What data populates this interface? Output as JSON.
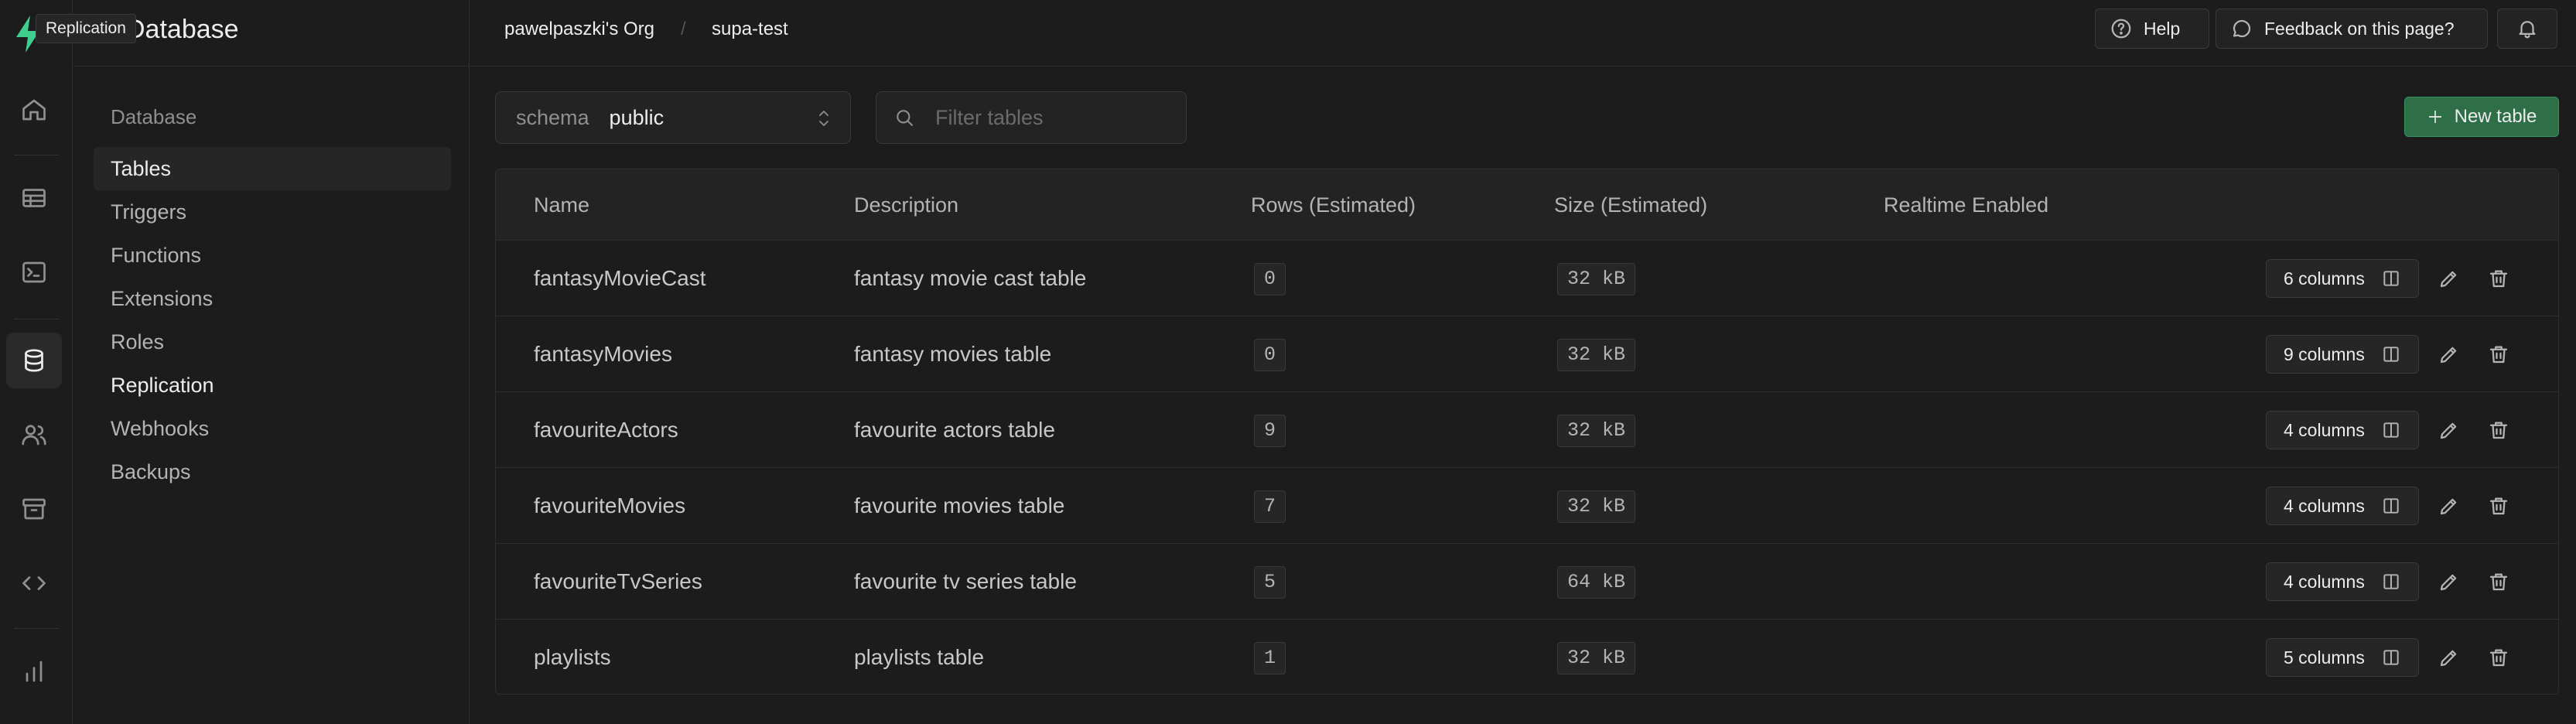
{
  "tooltip": "Replication",
  "sidebar": {
    "title": "Database",
    "section": "Database",
    "items": [
      {
        "label": "Tables"
      },
      {
        "label": "Triggers"
      },
      {
        "label": "Functions"
      },
      {
        "label": "Extensions"
      },
      {
        "label": "Roles"
      },
      {
        "label": "Replication"
      },
      {
        "label": "Webhooks"
      },
      {
        "label": "Backups"
      }
    ]
  },
  "rail": {
    "icons": [
      "home-icon",
      "table-editor-icon",
      "sql-editor-icon",
      "database-icon",
      "users-icon",
      "storage-icon",
      "api-icon",
      "reports-icon"
    ]
  },
  "topbar": {
    "org": "pawelpaszki's Org",
    "separator": "/",
    "project": "supa-test",
    "help_label": "Help",
    "feedback_label": "Feedback on this page?"
  },
  "toolbar": {
    "schema_label": "schema",
    "schema_value": "public",
    "filter_placeholder": "Filter tables",
    "new_table_label": "New table"
  },
  "table": {
    "headers": {
      "name": "Name",
      "description": "Description",
      "rows": "Rows (Estimated)",
      "size": "Size (Estimated)",
      "realtime": "Realtime Enabled"
    },
    "rows": [
      {
        "name": "fantasyMovieCast",
        "description": "fantasy movie cast table",
        "rows": "0",
        "size": "32 kB",
        "columns": "6 columns"
      },
      {
        "name": "fantasyMovies",
        "description": "fantasy movies table",
        "rows": "0",
        "size": "32 kB",
        "columns": "9 columns"
      },
      {
        "name": "favouriteActors",
        "description": "favourite actors table",
        "rows": "9",
        "size": "32 kB",
        "columns": "4 columns"
      },
      {
        "name": "favouriteMovies",
        "description": "favourite movies table",
        "rows": "7",
        "size": "32 kB",
        "columns": "4 columns"
      },
      {
        "name": "favouriteTvSeries",
        "description": "favourite tv series table",
        "rows": "5",
        "size": "64 kB",
        "columns": "4 columns"
      },
      {
        "name": "playlists",
        "description": "playlists table",
        "rows": "1",
        "size": "32 kB",
        "columns": "5 columns"
      }
    ]
  },
  "colors": {
    "background": "#1c1c1c",
    "accent": "#3ecf8e",
    "primary_button": "#2f6f48"
  }
}
